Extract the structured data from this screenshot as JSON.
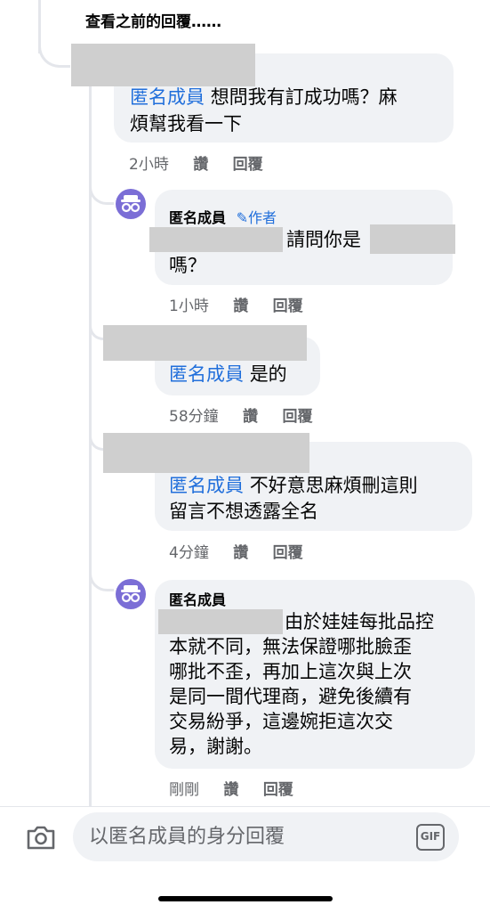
{
  "thread": {
    "view_previous": "查看之前的回覆……"
  },
  "comments": [
    {
      "name": "匿名成員",
      "text_line1": "想問我有訂成功嗎？麻",
      "text_line2": "煩幫我看一下",
      "time": "2小時",
      "like": "讚",
      "reply": "回覆"
    },
    {
      "name": "匿名成員",
      "author_badge": "✎作者",
      "text_part": "請問你是",
      "text_line2": "嗎？",
      "time": "1小時",
      "like": "讚",
      "reply": "回覆"
    },
    {
      "name": "匿名成員",
      "text_line1": "是的",
      "time": "58分鐘",
      "like": "讚",
      "reply": "回覆"
    },
    {
      "name": "匿名成員",
      "text_line1": "不好意思麻煩刪這則",
      "text_line2": "留言不想透露全名",
      "time": "4分鐘",
      "like": "讚",
      "reply": "回覆"
    },
    {
      "name": "匿名成員",
      "text_line1": "由於娃娃每批品控",
      "text_line2": "本就不同，無法保證哪批臉歪",
      "text_line3": "哪批不歪，再加上這次與上次",
      "text_line4": "是同一間代理商，避免後續有",
      "text_line5": "交易紛爭，這邊婉拒這次交",
      "text_line6": "易，謝謝。",
      "time": "剛剛",
      "like": "讚",
      "reply": "回覆"
    }
  ],
  "composer": {
    "placeholder": "以匿名成員的身分回覆",
    "camera_icon": "camera-icon",
    "gif_icon": "gif-icon",
    "gif_label": "GIF"
  },
  "colors": {
    "link": "#216fdb",
    "bubble": "#f0f2f5",
    "meta": "#65676b",
    "avatar": "#7b6ed6"
  }
}
